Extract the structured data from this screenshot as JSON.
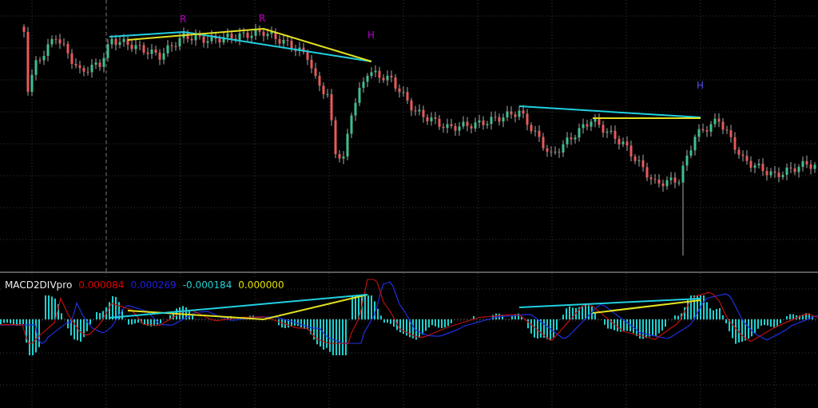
{
  "price_panel": {
    "pattern_labels": [
      {
        "text": "R",
        "color": "#c000c0"
      },
      {
        "text": "R",
        "color": "#c000c0"
      },
      {
        "text": "H",
        "color": "#b000c8"
      },
      {
        "text": "H",
        "color": "#5a4ae8"
      }
    ]
  },
  "indicator_panel": {
    "name": "MACD2DIVpro",
    "values": [
      {
        "text": "0.000084",
        "color": "#e00000"
      },
      {
        "text": "0.000269",
        "color": "#2020e0"
      },
      {
        "text": "-0.000184",
        "color": "#20d0d0"
      },
      {
        "text": "0.000000",
        "color": "#e0e000"
      }
    ]
  }
}
